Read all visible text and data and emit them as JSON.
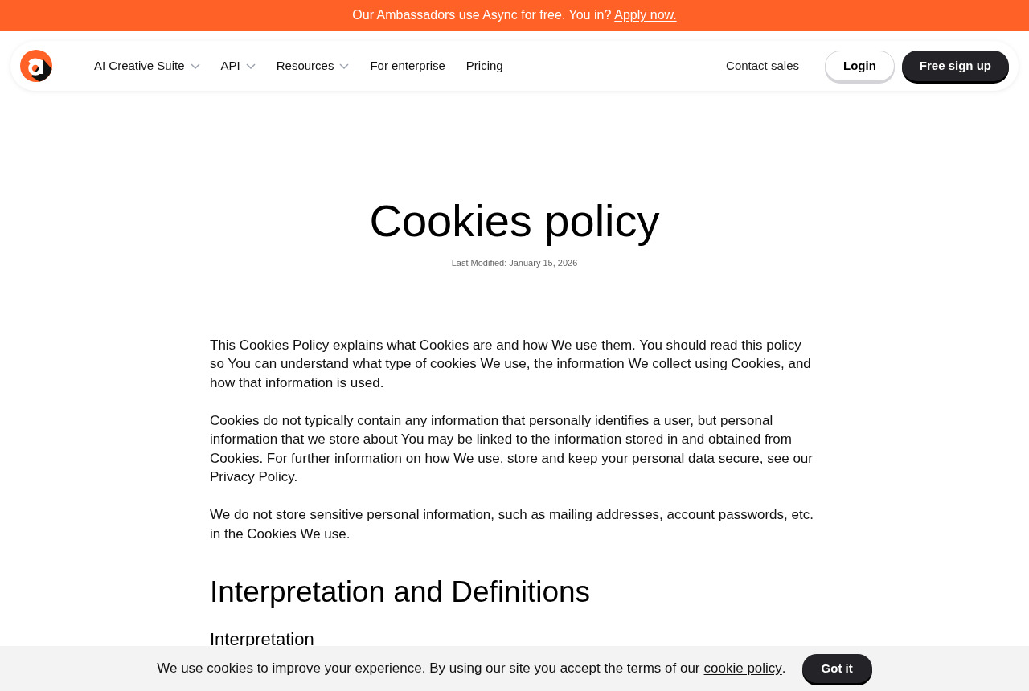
{
  "announcement": {
    "text": "Our Ambassadors use Async for free. You in?",
    "link": "Apply now."
  },
  "nav": {
    "items": [
      {
        "label": "AI Creative Suite",
        "dropdown": true
      },
      {
        "label": "API",
        "dropdown": true
      },
      {
        "label": "Resources",
        "dropdown": true
      },
      {
        "label": "For enterprise",
        "dropdown": false
      },
      {
        "label": "Pricing",
        "dropdown": false
      }
    ],
    "contact": "Contact sales",
    "login": "Login",
    "signup": "Free sign up"
  },
  "page": {
    "title": "Cookies policy",
    "last_modified": "Last Modified: January 15, 2026",
    "paragraphs": [
      "This Cookies Policy explains what Cookies are and how We use them. You should read this policy so You can understand what type of cookies We use, the information We collect using Cookies, and how that information is used.",
      "Cookies do not typically contain any information that personally identifies a user, but personal information that we store about You may be linked to the information stored in and obtained from Cookies. For further information on how We use, store and keep your personal data secure, see our Privacy Policy.",
      "We do not store sensitive personal information, such as mailing addresses, account passwords, etc. in the Cookies We use."
    ],
    "sections": [
      {
        "heading": "Interpretation and Definitions",
        "subheading": "Interpretation"
      }
    ]
  },
  "cookie_banner": {
    "text": "We use cookies to improve your experience. By using our site you accept the terms of our",
    "link": "cookie policy",
    "after": ".",
    "button": "Got it"
  }
}
